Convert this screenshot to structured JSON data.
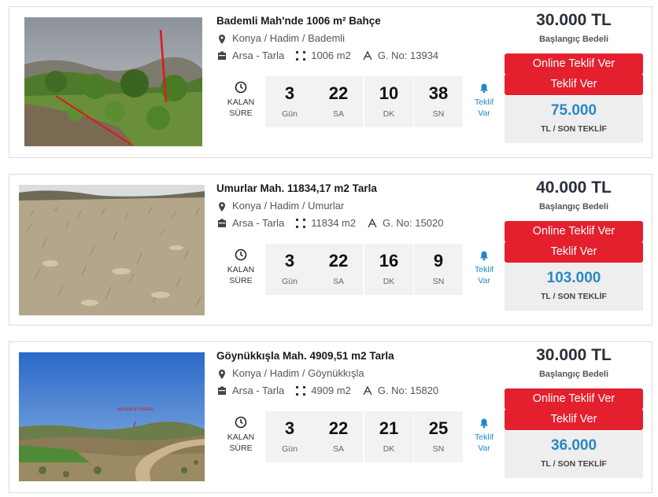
{
  "listings": [
    {
      "title": "Bademli Mah'nde 1006 m² Bahçe",
      "location": "Konya / Hadim / Bademli",
      "category": "Arsa - Tarla",
      "area": "1006 m2",
      "g_no": "G. No: 13934",
      "countdown": {
        "label_line1": "KALAN",
        "label_line2": "SÜRE",
        "days": "3",
        "days_unit": "Gün",
        "hours": "22",
        "hours_unit": "SA",
        "minutes": "10",
        "minutes_unit": "DK",
        "seconds": "38",
        "seconds_unit": "SN"
      },
      "bid_status_line1": "Teklif",
      "bid_status_line2": "Var",
      "start_price": "30.000 TL",
      "start_price_label": "Başlangıç Bedeli",
      "online_bid_label": "Online Teklif Ver",
      "bid_label": "Teklif Ver",
      "last_bid": "75.000",
      "last_bid_label": "TL / SON TEKLİF",
      "photo_icon": "orchard-photo"
    },
    {
      "title": "Umurlar Mah. 11834,17 m2 Tarla",
      "location": "Konya / Hadim / Umurlar",
      "category": "Arsa - Tarla",
      "area": "11834 m2",
      "g_no": "G. No: 15020",
      "countdown": {
        "label_line1": "KALAN",
        "label_line2": "SÜRE",
        "days": "3",
        "days_unit": "Gün",
        "hours": "22",
        "hours_unit": "SA",
        "minutes": "16",
        "minutes_unit": "DK",
        "seconds": "9",
        "seconds_unit": "SN"
      },
      "bid_status_line1": "Teklif",
      "bid_status_line2": "Var",
      "start_price": "40.000 TL",
      "start_price_label": "Başlangıç Bedeli",
      "online_bid_label": "Online Teklif Ver",
      "bid_label": "Teklif Ver",
      "last_bid": "103.000",
      "last_bid_label": "TL / SON TEKLİF",
      "photo_icon": "dry-field-photo"
    },
    {
      "title": "Göynükkışla Mah. 4909,51 m2 Tarla",
      "location": "Konya / Hadim / Göynükkışla",
      "category": "Arsa - Tarla",
      "area": "4909 m2",
      "g_no": "G. No: 15820",
      "countdown": {
        "label_line1": "KALAN",
        "label_line2": "SÜRE",
        "days": "3",
        "days_unit": "Gün",
        "hours": "22",
        "hours_unit": "SA",
        "minutes": "21",
        "minutes_unit": "DK",
        "seconds": "25",
        "seconds_unit": "SN"
      },
      "bid_status_line1": "Teklif",
      "bid_status_line2": "Var",
      "start_price": "30.000 TL",
      "start_price_label": "Başlangıç Bedeli",
      "online_bid_label": "Online Teklif Ver",
      "bid_label": "Teklif Ver",
      "last_bid": "36.000",
      "last_bid_label": "TL / SON TEKLİF",
      "photo_icon": "hillside-road-photo",
      "photo_overlay_text": "349 ADA 40 PARSEL"
    }
  ],
  "colors": {
    "accent_red": "#e4202e",
    "bid_blue": "#2b88c4",
    "link_blue": "#1e88c8",
    "price_dark": "#2a2f3a"
  }
}
